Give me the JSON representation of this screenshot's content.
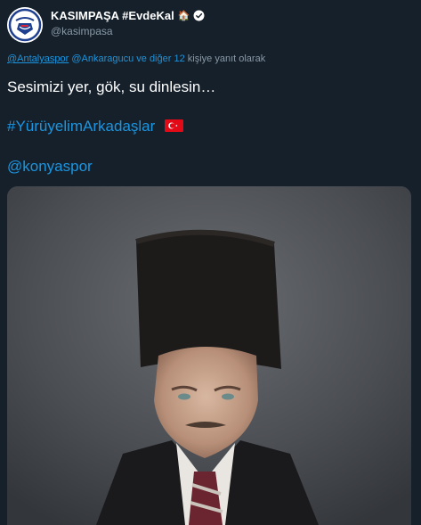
{
  "profile": {
    "display_name": "KASIMPAŞA #EvdeKal",
    "house_emoji": "🏠",
    "handle": "@kasimpasa",
    "avatar_icon": "kasimpasa-club-crest"
  },
  "reply_context": {
    "mention_1": "@Antalyaspor",
    "mention_2": "@Ankaragucu",
    "and_others": "ve diğer 12",
    "suffix": "kişiye yanıt olarak"
  },
  "tweet": {
    "line1": "Sesimizi yer, gök, su dinlesin…",
    "hashtag": "#YürüyelimArkadaşlar",
    "flag_icon": "turkey-flag-icon",
    "mention": "@konyaspor"
  },
  "colors": {
    "background": "#15202b",
    "link": "#1b95e0",
    "muted": "#8899a6"
  }
}
